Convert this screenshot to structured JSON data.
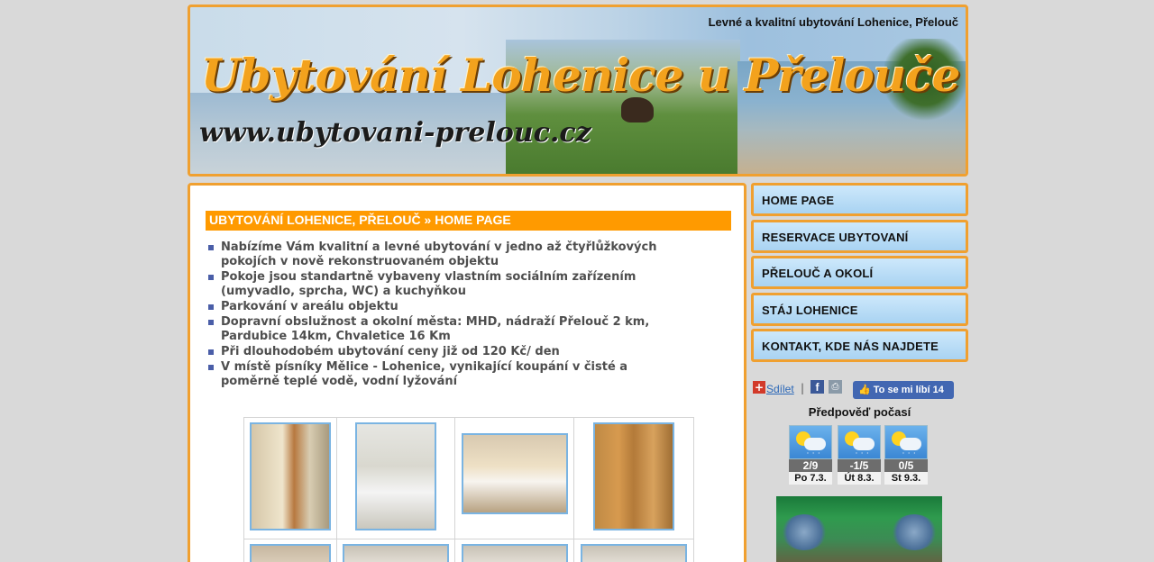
{
  "header": {
    "tagline": "Levné a kvalitní ubytování Lohenice, Přelouč",
    "title": "Ubytování Lohenice u Přelouče",
    "url": "www.ubytovani-prelouc.cz"
  },
  "main": {
    "heading": "UBYTOVÁNÍ LOHENICE, PŘELOUČ » HOME PAGE",
    "features": [
      "Nabízíme Vám kvalitní a levné ubytování v jedno až čtyřlůžkových pokojích v nově rekonstruovaném objektu",
      "Pokoje jsou standartně vybaveny vlastním sociálním zařízením (umyvadlo, sprcha, WC) a kuchyňkou",
      "Parkování v areálu objektu",
      "Dopravní obslužnost a okolní města: MHD, nádraží Přelouč 2 km, Pardubice 14km, Chvaletice 16 Km",
      "Při dlouhodobém ubytování ceny již od 120 Kč/ den",
      "V místě písníky Mělice - Lohenice, vynikající koupání v čisté a poměrně teplé vodě, vodní lyžování"
    ]
  },
  "nav": {
    "items": [
      {
        "label": "HOME PAGE"
      },
      {
        "label": "RESERVACE UBYTOVANÍ"
      },
      {
        "label": "PŘELOUČ A OKOLÍ"
      },
      {
        "label": "STÁJ LOHENICE"
      },
      {
        "label": "KONTAKT, KDE NÁS NAJDETE"
      }
    ]
  },
  "social": {
    "share_label": "Sdílet",
    "separator": "|",
    "like_label": "To se mi líbí 14"
  },
  "weather": {
    "title": "Předpověď počasí",
    "days": [
      {
        "temp": "2/9",
        "date": "Po 7.3."
      },
      {
        "temp": "-1/5",
        "date": "Út 8.3."
      },
      {
        "temp": "0/5",
        "date": "St 9.3."
      }
    ]
  },
  "colors": {
    "accent": "#f0a030",
    "heading_bg": "#ff9a00",
    "nav_bg": "#a9d3f2"
  },
  "icons": {
    "share": "plus-icon",
    "facebook": "facebook-icon",
    "print": "print-icon",
    "weather": "sun-cloud-rain-icon"
  }
}
